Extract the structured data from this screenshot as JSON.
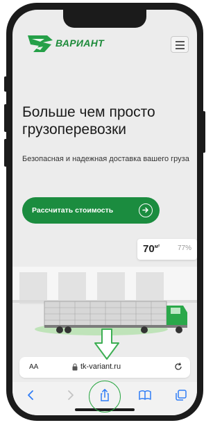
{
  "brand": {
    "name": "ВАРИАНТ"
  },
  "hero": {
    "title": "Больше чем просто грузоперевозки",
    "subtitle": "Безопасная и надежная доставка вашего груза",
    "cta_label": "Рассчитать стоимость"
  },
  "stat": {
    "area_value": "70",
    "area_unit": "м²",
    "percent": "77%"
  },
  "browser": {
    "text_size_label": "AA",
    "url": "tk-variant.ru"
  },
  "colors": {
    "accent": "#1b8c3f",
    "highlight": "#2ea846"
  },
  "icons": [
    "lock-icon",
    "reload-icon",
    "back-icon",
    "forward-icon",
    "share-icon",
    "bookmarks-icon",
    "tabs-icon",
    "menu-icon",
    "arrow-right-icon",
    "down-arrow-icon"
  ]
}
